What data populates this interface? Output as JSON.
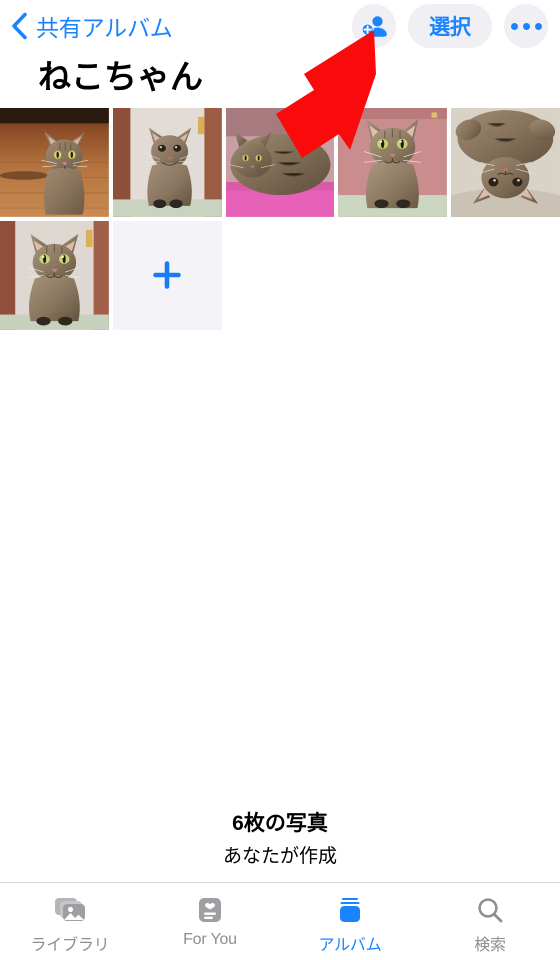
{
  "navbar": {
    "back_icon": "chevron-left-icon",
    "back_label": "共有アルバム",
    "add_people_icon": "person-add-icon",
    "select_label": "選択",
    "more_icon": "ellipsis-icon"
  },
  "album": {
    "title": "ねこちゃん",
    "photo_count_label": "6枚の写真",
    "creator_label": "あなたが作成"
  },
  "grid": {
    "add_tile_icon": "plus-icon",
    "photos": [
      {
        "name": "cat-sitting-on-wood-floor",
        "alt": "茶トラ猫がフローリングに座っている"
      },
      {
        "name": "cat-looking-up",
        "alt": "上を見上げる猫"
      },
      {
        "name": "cat-lying-on-pink-bed",
        "alt": "ピンクのベッドに寝そべる猫"
      },
      {
        "name": "cat-facing-camera",
        "alt": "正面を向いた猫"
      },
      {
        "name": "cat-upside-down",
        "alt": "仰向けに転がる猫"
      },
      {
        "name": "cat-sitting-portrait",
        "alt": "座っている猫のポートレート"
      }
    ]
  },
  "annotation": {
    "arrow_name": "red-arrow-pointing-to-add-people",
    "color": "#fa0a0a"
  },
  "tabbar": {
    "tabs": [
      {
        "label": "ライブラリ",
        "icon": "photo-stack-icon",
        "active": false
      },
      {
        "label": "For You",
        "icon": "heart-card-icon",
        "active": false
      },
      {
        "label": "アルバム",
        "icon": "albums-icon",
        "active": true
      },
      {
        "label": "検索",
        "icon": "magnifier-icon",
        "active": false
      }
    ]
  },
  "colors": {
    "accent": "#1a84ff",
    "chip_bg": "#efeff4",
    "inactive_tab": "#8e8e93",
    "add_tile_bg": "#f4f4f8",
    "annotation_red": "#fa0a0a"
  }
}
